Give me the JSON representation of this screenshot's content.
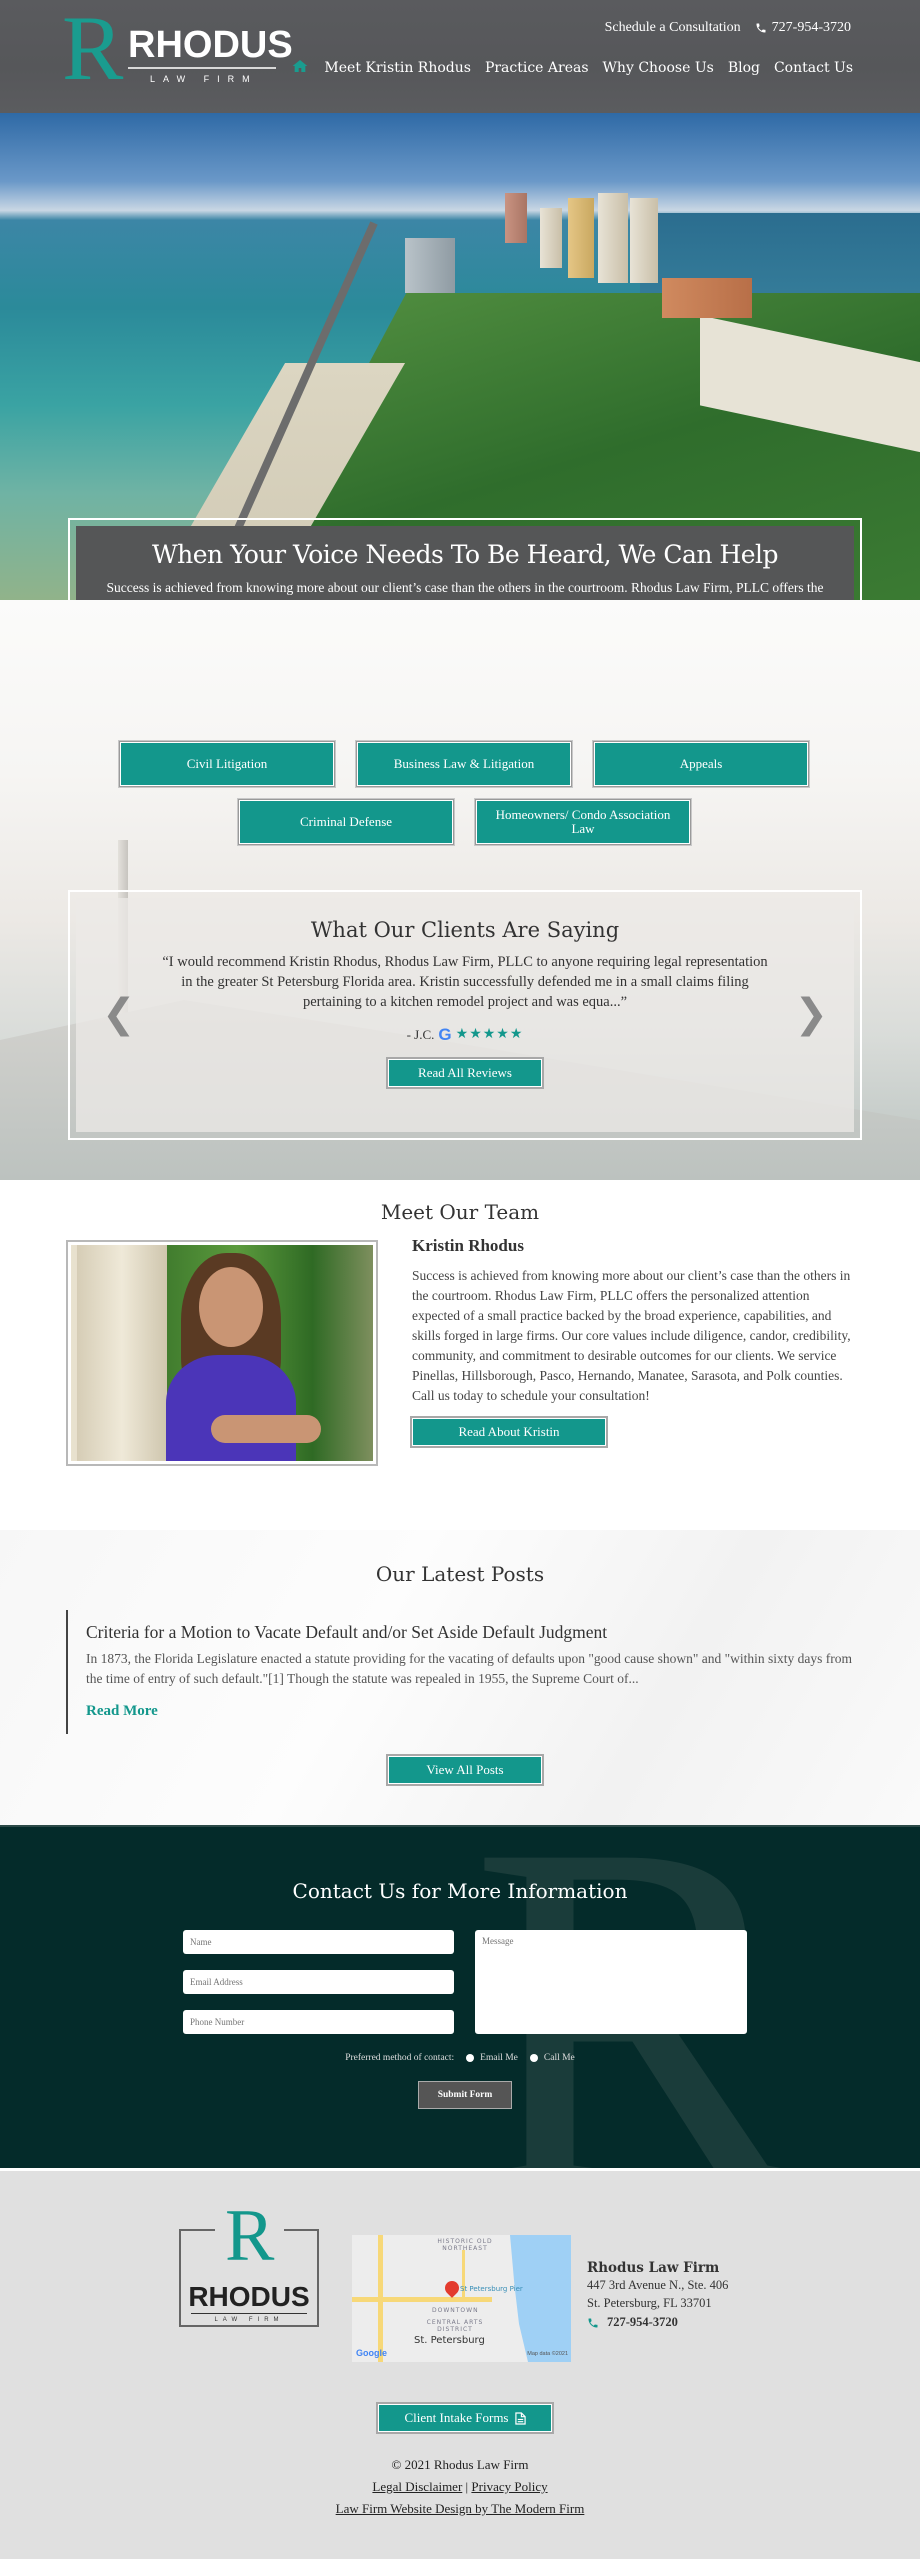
{
  "brand": {
    "logo_letter": "R",
    "logo_word": "RHODUS",
    "logo_sub": "LAW FIRM",
    "accent_color": "#13978c",
    "dark_color": "#042b2a"
  },
  "header": {
    "schedule_label": "Schedule a Consultation",
    "phone": "727-954-3720",
    "nav": [
      {
        "label": "Meet Kristin Rhodus"
      },
      {
        "label": "Practice Areas"
      },
      {
        "label": "Why Choose Us"
      },
      {
        "label": "Blog"
      },
      {
        "label": "Contact Us"
      }
    ]
  },
  "intro": {
    "title": "When Your Voice Needs To Be Heard, We Can Help",
    "body": "Success is achieved from knowing more about our client’s case than the others in the courtroom. Rhodus Law Firm, PLLC offers the personalized attention expected of a small firm backed by the broad experience, capabilities, and skills forged in large firms. Our core values include diligence, candor, reliability, community, and commitment to desirable outcomes for our clients."
  },
  "practice_areas": [
    {
      "label": "Civil Litigation"
    },
    {
      "label": "Business Law & Litigation"
    },
    {
      "label": "Appeals"
    },
    {
      "label": "Criminal Defense"
    },
    {
      "label": "Homeowners/ Condo Association Law"
    }
  ],
  "testimonials": {
    "title": "What Our Clients Are Saying",
    "quote": "“I would recommend Kristin Rhodus, Rhodus Law Firm, PLLC to anyone requiring legal representation in the greater St Petersburg Florida area. Kristin successfully defended me in a small claims filing pertaining to a kitchen remodel project and was equa...”",
    "author": "- J.C.",
    "source_icon": "G",
    "rating": 5,
    "rating_max": 5,
    "stars": "★★★★★",
    "prev_icon": "❮",
    "next_icon": "❯",
    "button_label": "Read All Reviews"
  },
  "team": {
    "title": "Meet Our Team",
    "name": "Kristin Rhodus",
    "bio": "Success is achieved from knowing more about our client’s case than the others in the courtroom. Rhodus Law Firm, PLLC offers the personalized attention expected of a small practice backed by the broad experience, capabilities, and skills forged in large firms. Our core values include diligence, candor, credibility, community, and commitment to desirable outcomes for our clients. We service Pinellas, Hillsborough, Pasco, Hernando, Manatee, Sarasota, and Polk counties. Call us today to schedule your consultation!",
    "button_label": "Read About Kristin"
  },
  "posts": {
    "title": "Our Latest Posts",
    "items": [
      {
        "title": "Criteria for a Motion to Vacate Default and/or Set Aside Default Judgment",
        "excerpt": "In 1873, the Florida Legislature enacted a statute providing for the vacating of defaults upon \"good cause shown\" and \"within sixty days from the time of entry of such default.\"[1] Though the statute was repealed in 1955, the Supreme Court of...",
        "read_more": "Read More"
      }
    ],
    "button_label": "View All Posts"
  },
  "contact": {
    "title": "Contact Us for More Information",
    "name_placeholder": "Name",
    "email_placeholder": "Email Address",
    "phone_placeholder": "Phone Number",
    "message_placeholder": "Message",
    "preferred_label": "Preferred method of contact:",
    "options": [
      {
        "label": "Email Me"
      },
      {
        "label": "Call Me"
      }
    ],
    "submit_label": "Submit Form"
  },
  "footer": {
    "map": {
      "label_north": "HISTORIC OLD NORTHEAST",
      "label_pier": "St Petersburg Pier",
      "label_downtown": "DOWNTOWN",
      "label_arts": "CENTRAL ARTS DISTRICT",
      "label_city": "St. Petersburg",
      "label_google": "Google",
      "label_credit": "Map data ©2021"
    },
    "firm_name": "Rhodus Law Firm",
    "address_line1": "447 3rd Avenue N., Ste. 406",
    "address_line2": "St. Petersburg, FL 33701",
    "phone": "727-954-3720",
    "intake_label": "Client Intake Forms",
    "copyright": "© 2021 Rhodus Law Firm",
    "legal_disclaimer": "Legal Disclaimer",
    "separator": "|",
    "privacy_policy": "Privacy Policy",
    "credit_link": "Law Firm Website Design by The Modern Firm"
  }
}
